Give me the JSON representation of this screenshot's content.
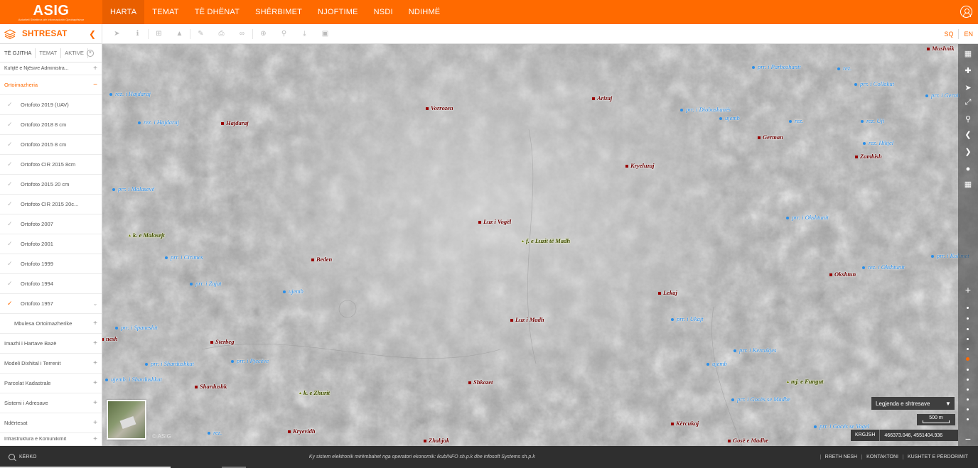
{
  "logo": {
    "text": "ASIG",
    "subtitle": "Autoriteti Shtetëror për Informacionin Gjeohapësinor"
  },
  "nav": [
    "HARTA",
    "TEMAT",
    "TË DHËNAT",
    "SHËRBIMET",
    "NJOFTIME",
    "NSDI",
    "NDIHMË"
  ],
  "nav_active": "HARTA",
  "panel": {
    "title": "SHTRESAT"
  },
  "languages": [
    "SQ",
    "EN"
  ],
  "tabs": [
    "TË GJITHA",
    "TEMAT",
    "AKTIVE"
  ],
  "sidebar": {
    "top_partial": "Kufijtë e Njësive Administra...",
    "open_category": "Ortoimazheria",
    "sub_items": [
      {
        "label": "Ortofoto 2019 (UAV)",
        "on": false
      },
      {
        "label": "Ortofoto 2018 8 cm",
        "on": false
      },
      {
        "label": "Ortofoto 2015 8 cm",
        "on": false
      },
      {
        "label": "Ortofoto CIR 2015 8cm",
        "on": false
      },
      {
        "label": "Ortofoto 2015 20 cm",
        "on": false
      },
      {
        "label": "Ortofoto CIR 2015 20c...",
        "on": false
      },
      {
        "label": "Ortofoto 2007",
        "on": false
      },
      {
        "label": "Ortofoto 2001",
        "on": false
      },
      {
        "label": "Ortofoto 1999",
        "on": false
      },
      {
        "label": "Ortofoto 1994",
        "on": false
      },
      {
        "label": "Ortofoto 1957",
        "on": true
      }
    ],
    "sub_category": "Mbulesa Ortoimazherike",
    "categories": [
      "Imazhi i Hartave Bazë",
      "Modeli Dixhital i Terrenit",
      "Parcelat Kadastrale",
      "Sistemi i Adresave",
      "Ndërtesat"
    ],
    "bottom_partial": "Infrastruktura e Komunikimit"
  },
  "map": {
    "villages": [
      {
        "name": "Vorrozen"
      },
      {
        "name": "Arizaj"
      },
      {
        "name": "Hajdaraj"
      },
      {
        "name": "German"
      },
      {
        "name": "Zambish"
      },
      {
        "name": "Kryeluzaj"
      },
      {
        "name": "Luz i Vogël"
      },
      {
        "name": "Beden"
      },
      {
        "name": "Okshtun"
      },
      {
        "name": "Lekaj"
      },
      {
        "name": "Luz i Madh"
      },
      {
        "name": "Sterbeg"
      },
      {
        "name": "Shkozet"
      },
      {
        "name": "Shardushk"
      },
      {
        "name": "Kryevidh"
      },
      {
        "name": "Zhabjak"
      },
      {
        "name": "Kërcukaj"
      },
      {
        "name": "Gosë e Madhe"
      },
      {
        "name": "Mushnik"
      },
      {
        "name": "nesh"
      }
    ],
    "streams": [
      {
        "name": "prr. i Parboshanit"
      },
      {
        "name": "rez."
      },
      {
        "name": "rez. i Hajdaraj"
      },
      {
        "name": "prr. i Collakut"
      },
      {
        "name": "prr. i Gernit"
      },
      {
        "name": "rez. i Hajdaraj"
      },
      {
        "name": "prr. i Dioboshanës"
      },
      {
        "name": "ujemb"
      },
      {
        "name": "rez."
      },
      {
        "name": "rez. Uji"
      },
      {
        "name": "rez. Hikjel"
      },
      {
        "name": "prr. i Malasevë"
      },
      {
        "name": "prr. i Okshtunit"
      },
      {
        "name": "prr. i Cirimes"
      },
      {
        "name": "prr. i Kollmet"
      },
      {
        "name": "prr. i Zajat"
      },
      {
        "name": "rez. i Okshtunit"
      },
      {
        "name": "ujemb"
      },
      {
        "name": "prr. i Ukajt"
      },
      {
        "name": "prr. i Spaneshit"
      },
      {
        "name": "prr. i Kercukjes"
      },
      {
        "name": "prr. i Shardushkut"
      },
      {
        "name": "prr. i Pjecëve"
      },
      {
        "name": "ujemb"
      },
      {
        "name": "ujemb. i Shardushkut"
      },
      {
        "name": "prr. i Gocës se Madhe"
      },
      {
        "name": "prr. i Gocës se Vogel"
      },
      {
        "name": "rez."
      }
    ],
    "peaks": [
      {
        "name": "k. e Malosejt"
      },
      {
        "name": "f. e Luzit të Madh"
      },
      {
        "name": "k. e Zhurit"
      },
      {
        "name": "mj. e Fungut"
      }
    ],
    "watermark": "© ASIG"
  },
  "legend_label": "Legjenda e shtresave",
  "scale_label": "500 m",
  "coords": {
    "crs": "KRGJSH",
    "value": "466373.046, 4551404.936"
  },
  "footer": {
    "search": "KËRKO",
    "notice": "Ky sistem elektronik mirëmbahet nga operatori ekonomik: ikubINFO sh.p.k dhe infosoft Systems sh.p.k",
    "links": [
      "RRETH NESH",
      "KONTAKTONI",
      "KUSHTET E PËRDORIMIT"
    ]
  }
}
